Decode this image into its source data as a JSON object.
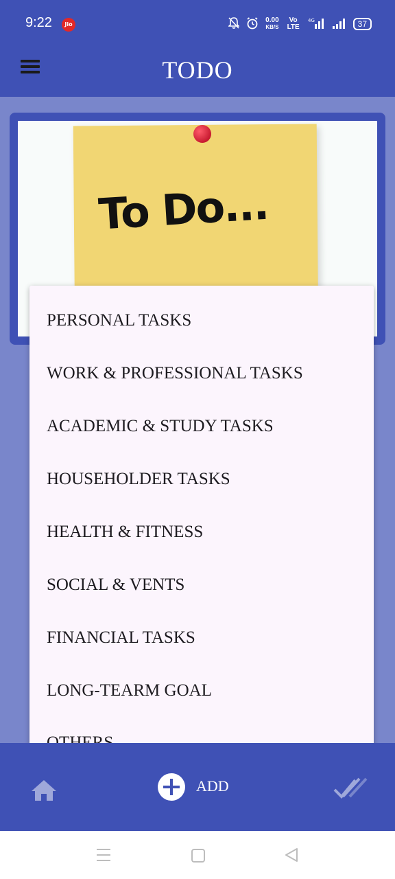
{
  "status_bar": {
    "time": "9:22",
    "carrier_badge": "Jio",
    "net_speed_value": "0.00",
    "net_speed_unit": "KB/S",
    "volte": "Vo LTE",
    "network_type": "4G",
    "battery": "37"
  },
  "app_bar": {
    "title": "TODO",
    "menu_icon": "hamburger-menu-icon"
  },
  "hero_image": {
    "caption_text": "To Do...",
    "description_icon": "sticky-note-with-pin"
  },
  "dropdown": {
    "items": [
      "PERSONAL TASKS",
      "WORK & PROFESSIONAL TASKS",
      "ACADEMIC & STUDY TASKS",
      "HOUSEHOLDER TASKS",
      "HEALTH & FITNESS",
      "SOCIAL & VENTS",
      "FINANCIAL TASKS",
      "LONG-TEARM GOAL",
      "OTHERS"
    ]
  },
  "bottom_nav": {
    "home_icon": "home-icon",
    "add_label": "ADD",
    "done_icon": "done-all-icon"
  },
  "colors": {
    "primary": "#3f51b5",
    "background": "#7986cb",
    "menu_surface": "#fcf5fd"
  }
}
